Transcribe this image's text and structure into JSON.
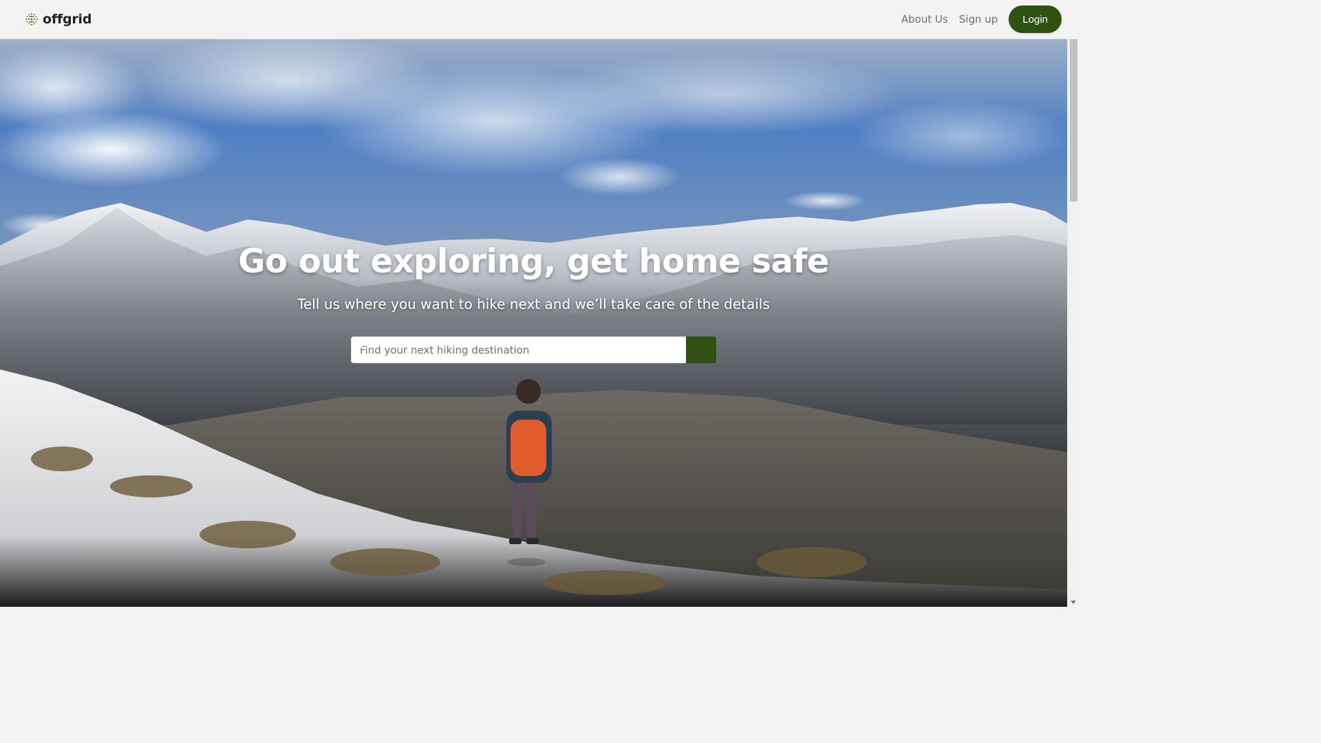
{
  "brand": {
    "name": "offgrid",
    "logo_icon": "dotted-globe-icon",
    "accent_color": "#2f5113"
  },
  "nav": {
    "about_label": "About Us",
    "signup_label": "Sign up",
    "login_label": "Login"
  },
  "hero": {
    "title": "Go out exploring, get home safe",
    "subtitle": "Tell us where you want to hike next and we’ll take care of the details",
    "background_image": "snowy mountain valley with hiker wearing orange backpack"
  },
  "search": {
    "placeholder": "Find your next hiking destination",
    "value": "",
    "button_icon": "search-icon"
  }
}
